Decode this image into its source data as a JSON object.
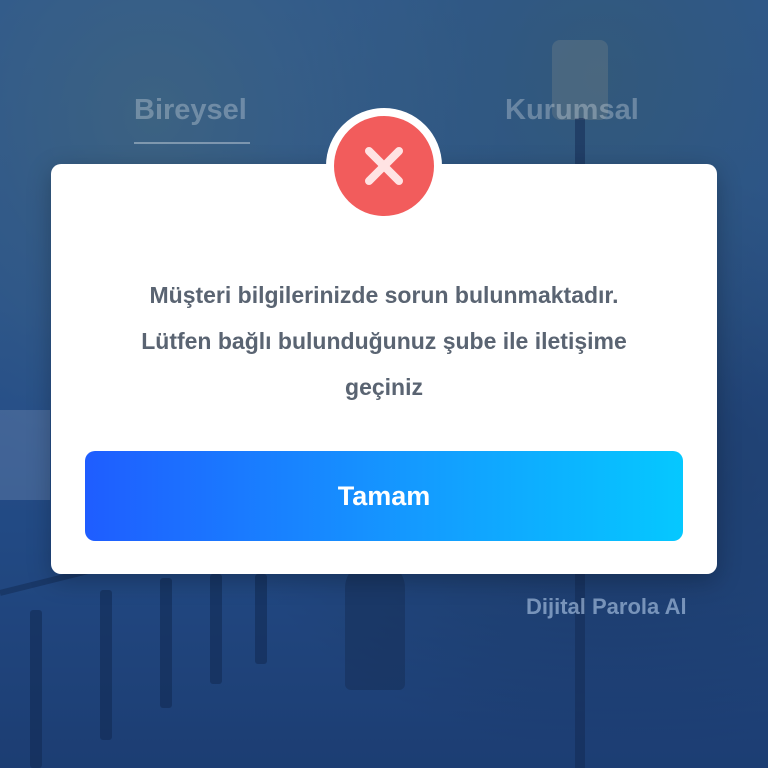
{
  "tabs": [
    {
      "label": "Bireysel",
      "active": true
    },
    {
      "label": "Kurumsal",
      "active": false
    }
  ],
  "bottom_link": "Dijital Parola Al",
  "dialog": {
    "icon": "error-x-icon",
    "message_lines": [
      "Müşteri bilgilerinizde sorun bulunmaktadır.",
      "Lütfen bağlı bulunduğunuz şube ile iletişime",
      "geçiniz"
    ],
    "button_label": "Tamam"
  },
  "colors": {
    "error_red": "#f25c5c",
    "button_gradient_start": "#1f5dff",
    "button_gradient_end": "#05c8ff",
    "message_text": "#5a6472"
  }
}
